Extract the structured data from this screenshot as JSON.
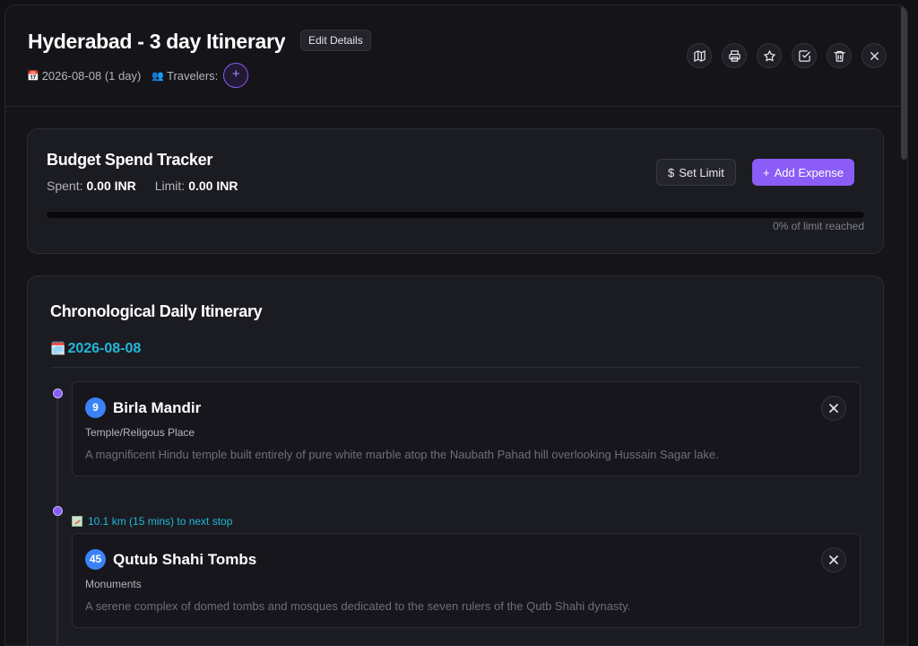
{
  "header": {
    "title": "Hyderabad - 3 day Itinerary",
    "edit_label": "Edit Details",
    "date_icon": "📅",
    "date_text": "2026-08-08 (1 day)",
    "travelers_icon": "👥",
    "travelers_label": "Travelers:",
    "add_traveler": "+",
    "actions": [
      "map-icon",
      "printer-icon",
      "star-icon",
      "check-square-icon",
      "trash-icon",
      "close-icon"
    ]
  },
  "budget": {
    "title": "Budget Spend Tracker",
    "spent_label": "Spent:",
    "spent_value": "0.00 INR",
    "limit_label": "Limit:",
    "limit_value": "0.00 INR",
    "set_limit_icon": "$",
    "set_limit_label": "Set Limit",
    "add_expense_icon": "+",
    "add_expense_label": "Add Expense",
    "progress_percent": 0,
    "progress_label": "0% of limit reached"
  },
  "itinerary": {
    "title": "Chronological Daily Itinerary",
    "day_icon": "🗓️",
    "day_date": "2026-08-08",
    "stops": [
      {
        "number": "9",
        "name": "Birla Mandir",
        "category": "Temple/Religous Place",
        "description": "A magnificent Hindu temple built entirely of pure white marble atop the Naubath Pahad hill overlooking Hussain Sagar lake."
      },
      {
        "number": "45",
        "name": "Qutub Shahi Tombs",
        "category": "Monuments",
        "description": "A serene complex of domed tombs and mosques dedicated to the seven rulers of the Qutb Shahi dynasty."
      }
    ],
    "distance_text": "10.1 km (15 mins) to next stop"
  },
  "colors": {
    "accent": "#8b5cf6",
    "date_cyan": "#22b8d8",
    "badge_blue": "#3b82f6",
    "background": "#141419"
  }
}
